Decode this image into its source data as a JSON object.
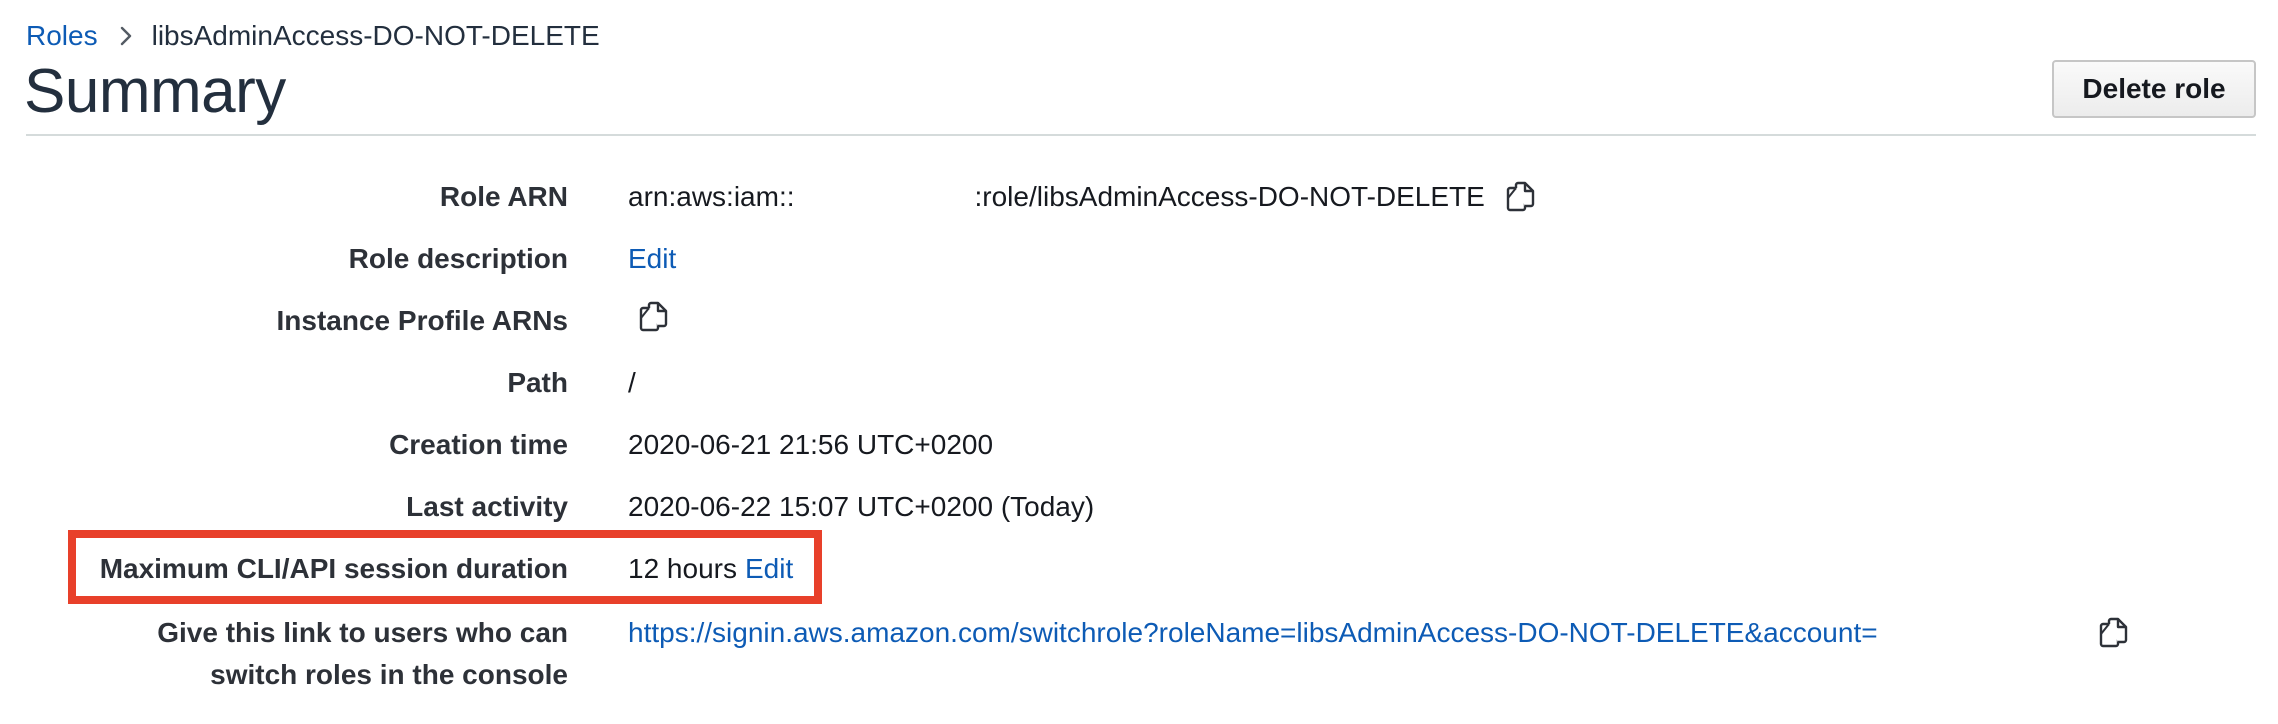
{
  "breadcrumb": {
    "parent": "Roles",
    "current": "libsAdminAccess-DO-NOT-DELETE"
  },
  "header": {
    "title": "Summary",
    "delete_label": "Delete role"
  },
  "details": {
    "role_arn": {
      "label": "Role ARN",
      "value_prefix": "arn:aws:iam::",
      "value_suffix": ":role/libsAdminAccess-DO-NOT-DELETE"
    },
    "role_description": {
      "label": "Role description",
      "edit": "Edit"
    },
    "instance_profile": {
      "label": "Instance Profile ARNs"
    },
    "path": {
      "label": "Path",
      "value": "/"
    },
    "creation_time": {
      "label": "Creation time",
      "value": "2020-06-21 21:56 UTC+0200"
    },
    "last_activity": {
      "label": "Last activity",
      "value": "2020-06-22 15:07 UTC+0200 (Today)"
    },
    "max_session": {
      "label": "Maximum CLI/API session duration",
      "value": "12 hours",
      "edit": "Edit"
    },
    "switch_link": {
      "label_line1": "Give this link to users who can",
      "label_line2": "switch roles in the console",
      "url": "https://signin.aws.amazon.com/switchrole?roleName=libsAdminAccess-DO-NOT-DELETE&account="
    }
  },
  "colors": {
    "link": "#0d5bb5",
    "highlight": "#e8402a"
  },
  "icons": {
    "copy": "copy-icon",
    "breadcrumb_separator": "chevron-right-icon"
  }
}
